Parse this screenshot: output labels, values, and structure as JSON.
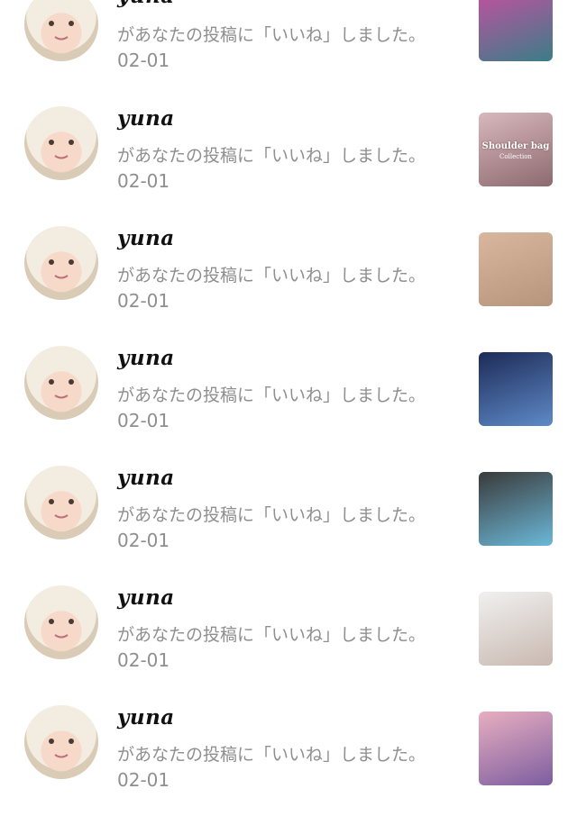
{
  "notifications": [
    {
      "user": "yuna",
      "message": "があなたの投稿に「いいね」しました。",
      "date": "02-01",
      "thumb_colors": [
        "#c64fa0",
        "#3b7d88"
      ],
      "thumb_text": "",
      "thumb_sub": ""
    },
    {
      "user": "yuna",
      "message": "があなたの投稿に「いいね」しました。",
      "date": "02-01",
      "thumb_colors": [
        "#d8b7bd",
        "#8d6a6f"
      ],
      "thumb_text": "Shoulder bag",
      "thumb_sub": "Collection"
    },
    {
      "user": "yuna",
      "message": "があなたの投稿に「いいね」しました。",
      "date": "02-01",
      "thumb_colors": [
        "#d8b79e",
        "#b6957c"
      ],
      "thumb_text": "",
      "thumb_sub": ""
    },
    {
      "user": "yuna",
      "message": "があなたの投稿に「いいね」しました。",
      "date": "02-01",
      "thumb_colors": [
        "#1d2b57",
        "#5e8ac8"
      ],
      "thumb_text": "",
      "thumb_sub": ""
    },
    {
      "user": "yuna",
      "message": "があなたの投稿に「いいね」しました。",
      "date": "02-01",
      "thumb_colors": [
        "#3a3a3a",
        "#6bb8d8"
      ],
      "thumb_text": "",
      "thumb_sub": ""
    },
    {
      "user": "yuna",
      "message": "があなたの投稿に「いいね」しました。",
      "date": "02-01",
      "thumb_colors": [
        "#f0f0f0",
        "#c9b9b0"
      ],
      "thumb_text": "",
      "thumb_sub": ""
    },
    {
      "user": "yuna",
      "message": "があなたの投稿に「いいね」しました。",
      "date": "02-01",
      "thumb_colors": [
        "#e8aec0",
        "#7d5ea0"
      ],
      "thumb_text": "",
      "thumb_sub": ""
    }
  ]
}
